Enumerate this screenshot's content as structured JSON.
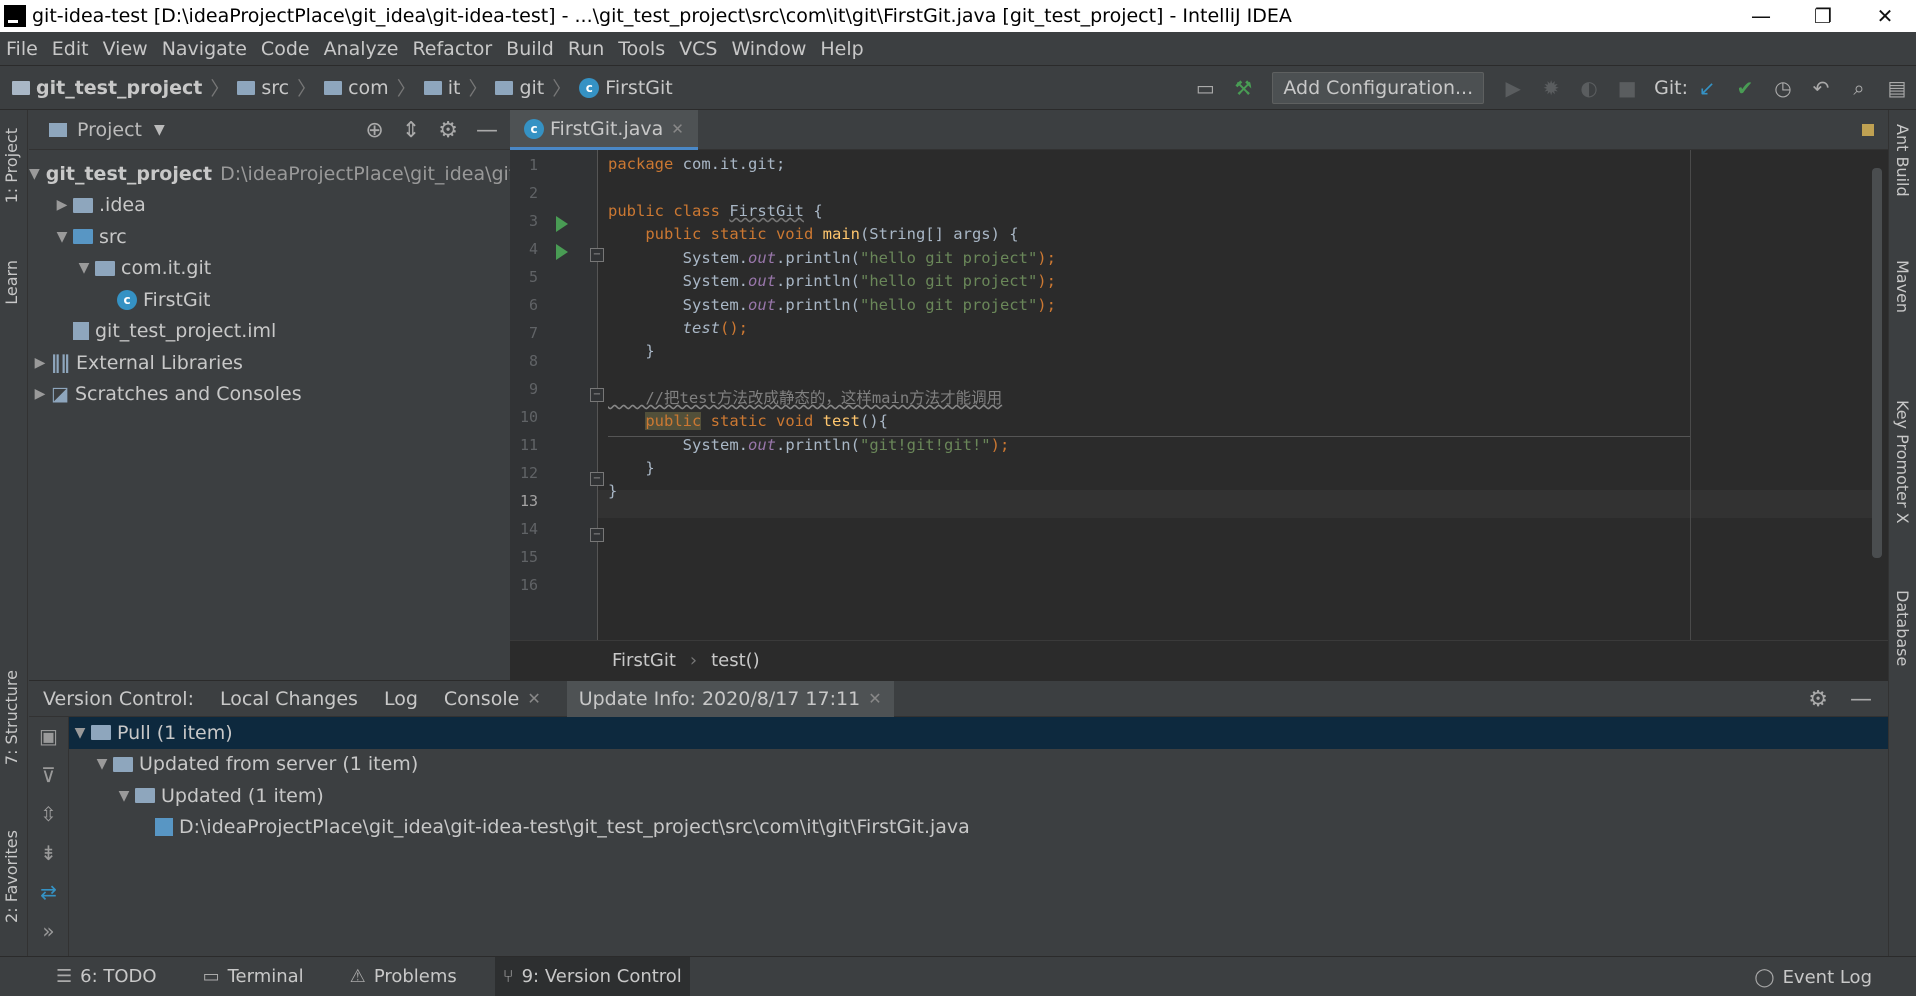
{
  "window": {
    "title": "git-idea-test [D:\\ideaProjectPlace\\git_idea\\git-idea-test] - ...\\git_test_project\\src\\com\\it\\git\\FirstGit.java [git_test_project] - IntelliJ IDEA",
    "min": "—",
    "restore": "❐",
    "close": "✕"
  },
  "menu": [
    "File",
    "Edit",
    "View",
    "Navigate",
    "Code",
    "Analyze",
    "Refactor",
    "Build",
    "Run",
    "Tools",
    "VCS",
    "Window",
    "Help"
  ],
  "breadcrumbs": {
    "project": "git_test_project",
    "src": "src",
    "com": "com",
    "it": "it",
    "git": "git",
    "file": "FirstGit"
  },
  "toolbar": {
    "add_config": "Add Configuration...",
    "git_label": "Git:"
  },
  "left_tabs": {
    "project": "1: Project",
    "learn": "Learn",
    "structure": "7: Structure",
    "favorites": "2: Favorites"
  },
  "right_tabs": {
    "ant": "Ant Build",
    "maven": "Maven",
    "keypromoter": "Key Promoter X",
    "database": "Database"
  },
  "project_panel": {
    "title": "Project",
    "root_name": "git_test_project",
    "root_path": "D:\\ideaProjectPlace\\git_idea\\git",
    "idea": ".idea",
    "src": "src",
    "package": "com.it.git",
    "class": "FirstGit",
    "iml": "git_test_project.iml",
    "libs": "External Libraries",
    "scratches": "Scratches and Consoles"
  },
  "editor": {
    "tab": "FirstGit.java",
    "line_numbers": [
      "1",
      "2",
      "3",
      "4",
      "5",
      "6",
      "7",
      "8",
      "9",
      "10",
      "11",
      "12",
      "13",
      "14",
      "15",
      "16"
    ],
    "code": {
      "l1_kw": "package",
      "l1_rest": " com.it.git;",
      "l3_kw": "public class ",
      "l3_name": "FirstGit",
      "l3_rest": " {",
      "l4_kw": "    public static void ",
      "l4_fn": "main",
      "l4_rest": "(String[] args) {",
      "sys": "        System.",
      "out": "out",
      "println": ".println(",
      "hello": "\"hello git project\"",
      "end": ");",
      "l8_test": "test",
      "l8_rest": "();",
      "close4": "    }",
      "l11_cmt": "    //把test方法改成静态的，这样main方法才能调用",
      "l12_pub": "public",
      "l12_kw": " static void ",
      "l12_fn": "test",
      "l12_rest": "(){",
      "l13_str": "\"git!git!git!\"",
      "close0": "}"
    },
    "crumb_class": "FirstGit",
    "crumb_method": "test()"
  },
  "version_control": {
    "label": "Version Control:",
    "tabs": [
      "Local Changes",
      "Log",
      "Console"
    ],
    "update_tab": "Update Info: 2020/8/17 17:11",
    "tree": {
      "pull": "Pull (1 item)",
      "server": "Updated from server (1 item)",
      "updated": "Updated (1 item)",
      "file": "D:\\ideaProjectPlace\\git_idea\\git-idea-test\\git_test_project\\src\\com\\it\\git\\FirstGit.java"
    }
  },
  "statusbar": {
    "todo": "6: TODO",
    "terminal": "Terminal",
    "problems": "Problems",
    "vc": "9: Version Control",
    "eventlog": "Event Log"
  }
}
